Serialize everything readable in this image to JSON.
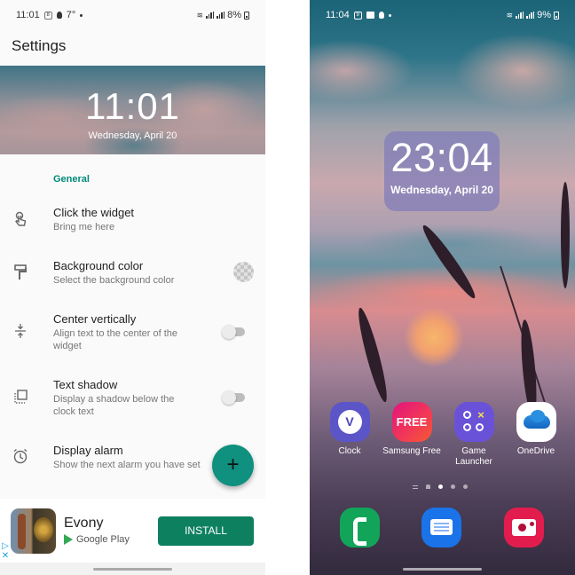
{
  "left_screen": {
    "status_bar": {
      "time": "11:01",
      "notif_badge": "8",
      "temperature": "7°",
      "battery": "8%"
    },
    "app_title": "Settings",
    "preview": {
      "time": "11:01",
      "date": "Wednesday, April 20"
    },
    "section_header": "General",
    "settings": [
      {
        "icon": "touch-icon",
        "title": "Click the widget",
        "subtitle": "Bring me here"
      },
      {
        "icon": "paint-roller-icon",
        "title": "Background color",
        "subtitle": "Select the background color",
        "control": "color-swatch"
      },
      {
        "icon": "vertical-align-center-icon",
        "title": "Center vertically",
        "subtitle": "Align text to the center of the widget",
        "control": "toggle",
        "enabled": false
      },
      {
        "icon": "shadow-icon",
        "title": "Text shadow",
        "subtitle": "Display a shadow below the clock text",
        "control": "toggle",
        "enabled": false
      },
      {
        "icon": "alarm-icon",
        "title": "Display alarm",
        "subtitle": "Show the next alarm you have set"
      }
    ],
    "fab": {
      "label": "+",
      "icon": "plus-icon"
    },
    "ad": {
      "app_name": "Evony",
      "store": "Google Play",
      "cta": "INSTALL",
      "adchoices_glyph": "▷",
      "close_glyph": "✕"
    },
    "colors": {
      "accent": "#00897b",
      "install": "#0d8060"
    }
  },
  "right_screen": {
    "status_bar": {
      "time": "11:04",
      "notif_badge": "9",
      "battery": "9%"
    },
    "widget": {
      "time": "23:04",
      "date": "Wednesday, April 20"
    },
    "apps": [
      {
        "label": "Clock",
        "icon": "clock-app-icon"
      },
      {
        "label": "Samsung Free",
        "icon": "samsung-free-icon",
        "glyph": "FREE"
      },
      {
        "label": "Game Launcher",
        "icon": "game-launcher-icon"
      },
      {
        "label": "OneDrive",
        "icon": "onedrive-icon"
      }
    ],
    "page_indicator": {
      "pages": 3,
      "active": 1
    },
    "dock": [
      {
        "label": "Phone",
        "icon": "phone-app-icon"
      },
      {
        "label": "Messages",
        "icon": "messages-app-icon"
      },
      {
        "label": "Camera",
        "icon": "camera-app-icon"
      }
    ]
  }
}
